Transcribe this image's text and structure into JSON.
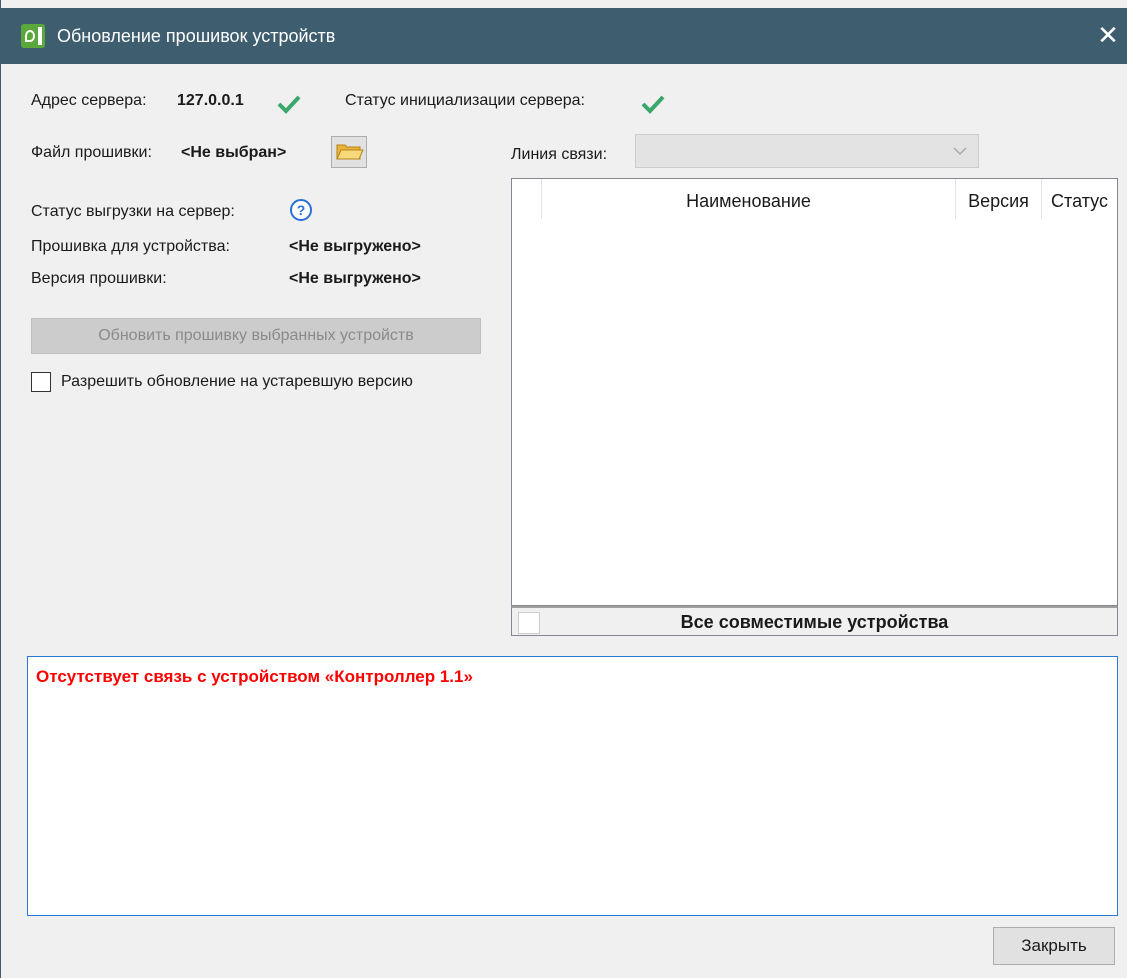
{
  "window": {
    "title": "Обновление прошивок устройств",
    "close_glyph": "✕"
  },
  "server": {
    "address_label": "Адрес сервера:",
    "address_value": "127.0.0.1",
    "init_status_label": "Статус инициализации сервера:"
  },
  "firmware": {
    "file_label": "Файл прошивки:",
    "file_value": "<Не выбран>"
  },
  "comm_line": {
    "label": "Линия связи:",
    "value": ""
  },
  "upload": {
    "status_label": "Статус выгрузки на сервер:",
    "device_label": "Прошивка для устройства:",
    "device_value": "<Не выгружено>",
    "version_label": "Версия прошивки:",
    "version_value": "<Не выгружено>"
  },
  "actions": {
    "update_button": "Обновить прошивку выбранных устройств",
    "allow_downgrade_label": "Разрешить обновление на устаревшую версию",
    "allow_downgrade_checked": false,
    "close_button": "Закрыть"
  },
  "device_table": {
    "columns": [
      "Наименование",
      "Версия",
      "Статус"
    ],
    "rows": [],
    "footer_label": "Все совместимые устройства"
  },
  "log": {
    "messages": [
      "Отсутствует связь с устройством «Контроллер 1.1»"
    ],
    "error_color": "#ff0000"
  },
  "colors": {
    "titlebar": "#3e5e70",
    "success_check": "#3aa76d",
    "help_icon": "#2b6fd6",
    "log_border": "#2b78d4"
  }
}
